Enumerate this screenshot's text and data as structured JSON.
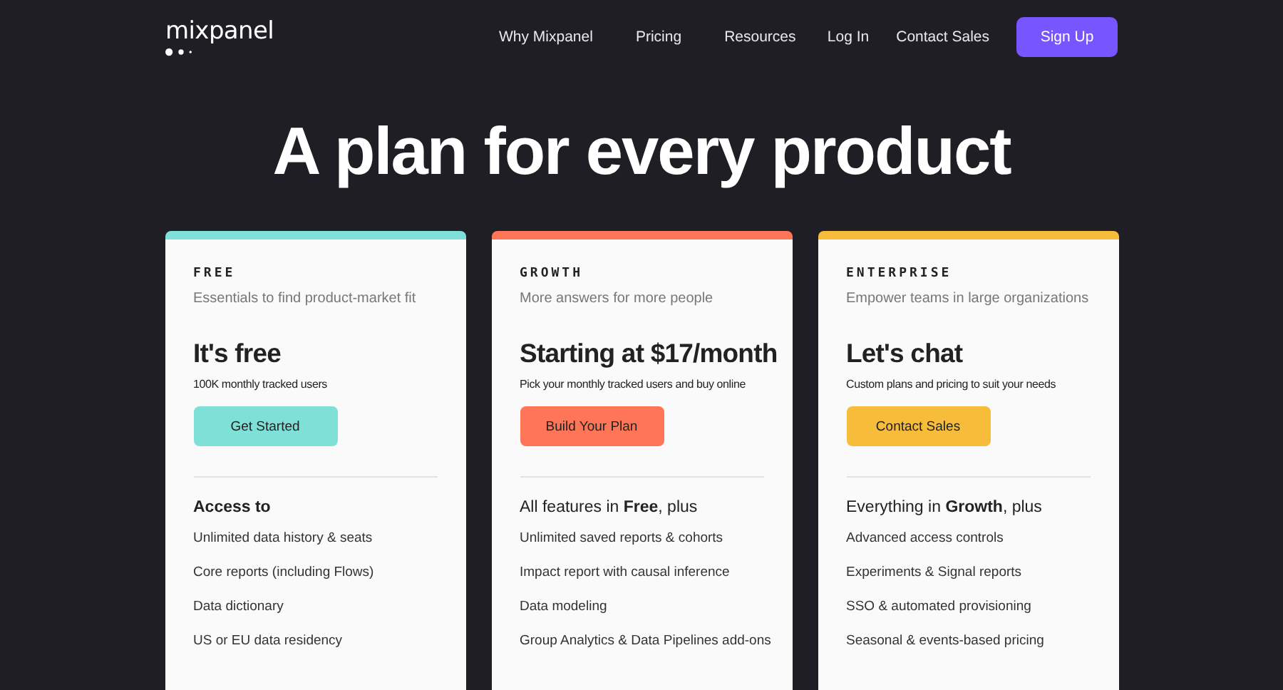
{
  "nav": {
    "logo": "mixpanel",
    "links": [
      "Why Mixpanel",
      "Pricing",
      "Resources"
    ],
    "login": "Log In",
    "contact": "Contact Sales",
    "signup": "Sign Up"
  },
  "heading": "A plan for every product",
  "plans": [
    {
      "tag": "FREE",
      "subtitle": "Essentials to find product-market fit",
      "price": "It's free",
      "note": "100K monthly tracked users",
      "button": "Get Started",
      "color": "#7ee0d6",
      "intro": {
        "text": "Access to",
        "bold": true
      },
      "features": [
        "Unlimited data history & seats",
        "Core reports (including Flows)",
        "Data dictionary",
        "US or EU data residency"
      ]
    },
    {
      "tag": "GROWTH",
      "subtitle": "More answers for more people",
      "price": "Starting at $17/month",
      "note": "Pick your monthly tracked users and buy online",
      "button": "Build Your Plan",
      "color": "#ff7557",
      "intro": {
        "text": "All features in **Free**, plus",
        "bold": false
      },
      "features": [
        "Unlimited saved reports & cohorts",
        "Impact report with causal inference",
        "Data modeling",
        "Group Analytics & Data Pipelines add-ons"
      ]
    },
    {
      "tag": "ENTERPRISE",
      "subtitle": "Empower teams in large organizations",
      "price": "Let's chat",
      "note": "Custom plans and pricing to suit your needs",
      "button": "Contact Sales",
      "color": "#f8bc3b",
      "intro": {
        "text": "Everything in **Growth**, plus",
        "bold": false
      },
      "features": [
        "Advanced access controls",
        "Experiments & Signal reports",
        "SSO & automated provisioning",
        "Seasonal & events-based pricing"
      ]
    }
  ]
}
